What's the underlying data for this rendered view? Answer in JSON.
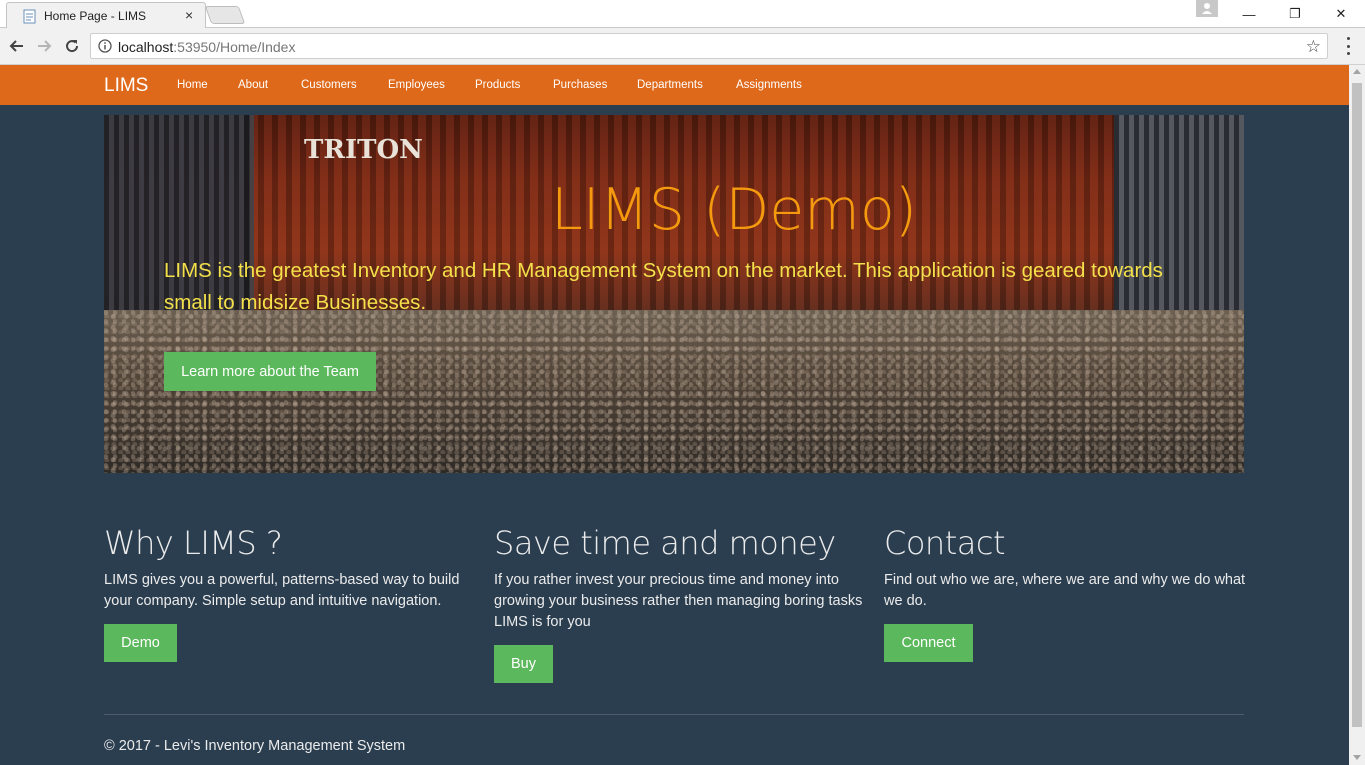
{
  "browser": {
    "tab_title": "Home Page - LIMS",
    "tab_close": "×",
    "url_host": "localhost",
    "url_rest": ":53950/Home/Index",
    "star": "☆",
    "win_minimize": "—",
    "win_restore": "❐",
    "win_close": "✕"
  },
  "navbar": {
    "brand": "LIMS",
    "links": [
      "Home",
      "About",
      "Customers",
      "Employees",
      "Products",
      "Purchases",
      "Departments",
      "Assignments"
    ]
  },
  "jumbotron": {
    "container_text": "TRITON",
    "title": "LIMS (Demo)",
    "lead": "LIMS is the greatest Inventory and HR Management System on the market. This application is geared towards small to midsize Businesses.",
    "button": "Learn more about the Team"
  },
  "columns": [
    {
      "title": "Why LIMS ?",
      "text": "LIMS gives you a powerful, patterns-based way to build your company. Simple setup and intuitive navigation.",
      "button": "Demo"
    },
    {
      "title": "Save time and money",
      "text": "If you rather invest your precious time and money into growing your business rather then managing boring tasks LIMS is for you",
      "button": "Buy"
    },
    {
      "title": "Contact",
      "text": "Find out who we are, where we are and why we do what we do.",
      "button": "Connect"
    }
  ],
  "footer": {
    "text": "© 2017 - Levi's Inventory Management System"
  },
  "colors": {
    "navbar": "#df691a",
    "page_bg": "#2b3e50",
    "button": "#5cb85c",
    "title": "#f59a0f",
    "lead": "#f3e04a"
  }
}
